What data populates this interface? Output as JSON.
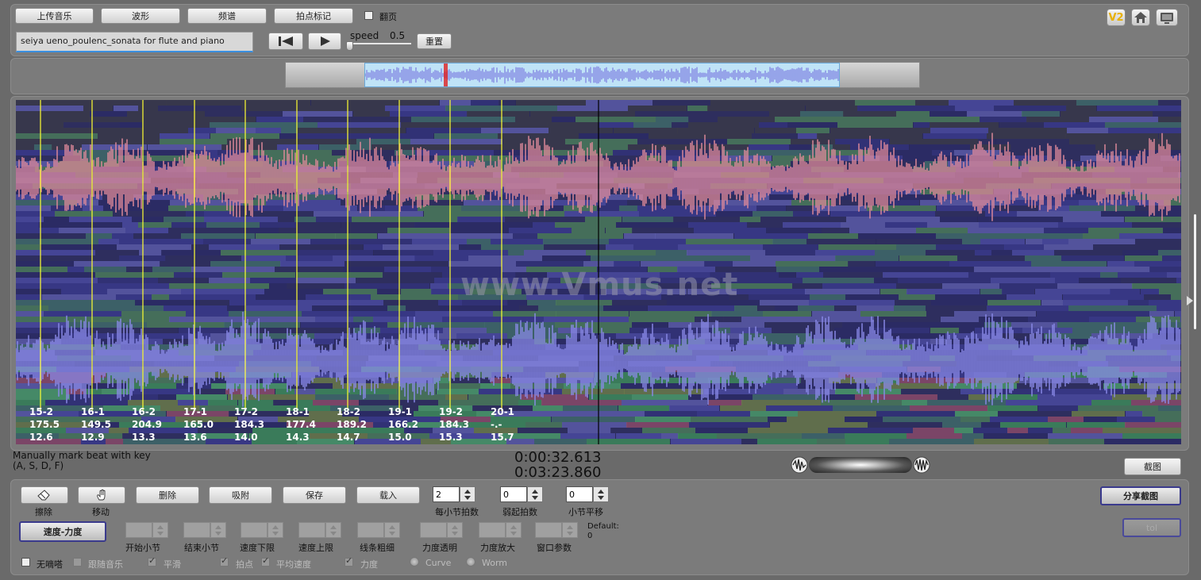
{
  "toolbar": {
    "upload_label": "上传音乐",
    "waveform_label": "波形",
    "spectrum_label": "频谱",
    "beat_mark_label": "拍点标记",
    "page_flip_label": "翻页",
    "filename": "seiya ueno_poulenc_sonata for flute and piano",
    "speed_label": "speed",
    "speed_value": "0.5",
    "reset_label": "重置",
    "v2_label": "V2"
  },
  "overview": {
    "playhead_fraction": 0.165
  },
  "spectrogram": {
    "watermark": "www.Vmus.net",
    "beats": [
      {
        "bar": "15-2",
        "tempo": "175.5",
        "time": "12.6"
      },
      {
        "bar": "16-1",
        "tempo": "149.5",
        "time": "12.9"
      },
      {
        "bar": "16-2",
        "tempo": "204.9",
        "time": "13.3"
      },
      {
        "bar": "17-1",
        "tempo": "165.0",
        "time": "13.6"
      },
      {
        "bar": "17-2",
        "tempo": "184.3",
        "time": "14.0"
      },
      {
        "bar": "18-1",
        "tempo": "177.4",
        "time": "14.3"
      },
      {
        "bar": "18-2",
        "tempo": "189.2",
        "time": "14.7"
      },
      {
        "bar": "19-1",
        "tempo": "166.2",
        "time": "15.0"
      },
      {
        "bar": "19-2",
        "tempo": "184.3",
        "time": "15.3"
      },
      {
        "bar": "20-1",
        "tempo": "-.-",
        "time": "15.7"
      }
    ]
  },
  "status": {
    "hint_line1": "Manually mark beat with key",
    "hint_line2": "(A, S, D, F)",
    "current_time": "0:00:32.613",
    "total_time": "0:03:23.860",
    "screenshot_label": "截图"
  },
  "tools": {
    "erase_label": "擦除",
    "move_label": "移动",
    "delete_label": "删除",
    "snap_label": "吸附",
    "save_label": "保存",
    "load_label": "载入",
    "beats_per_bar_label": "每小节拍数",
    "beats_per_bar_value": "2",
    "pickup_beats_label": "弱起拍数",
    "pickup_beats_value": "0",
    "bar_offset_label": "小节平移",
    "bar_offset_value": "0",
    "share_label": "分享截图",
    "tol_label": "tol",
    "tempo_dynamics_label": "速度-力度",
    "start_bar_label": "开始小节",
    "end_bar_label": "结束小节",
    "tempo_min_label": "速度下限",
    "tempo_max_label": "速度上限",
    "line_width_label": "线条粗细",
    "dyn_opacity_label": "力度透明",
    "dyn_zoom_label": "力度放大",
    "window_param_label": "窗口参数",
    "default_label": "Default:",
    "default_value": "0",
    "no_beep_label": "无嘀嗒",
    "follow_music_label": "跟随音乐",
    "smooth_label": "平滑",
    "beats_label": "拍点",
    "avg_tempo_label": "平均速度",
    "dynamics_label": "力度",
    "curve_label": "Curve",
    "worm_label": "Worm"
  },
  "colors": {
    "beat_line": "#ffff33",
    "waveform_pink": "#e08a9a",
    "waveform_blue": "#8a8ae8",
    "spectrogram_bg": "#2a2a5a"
  }
}
